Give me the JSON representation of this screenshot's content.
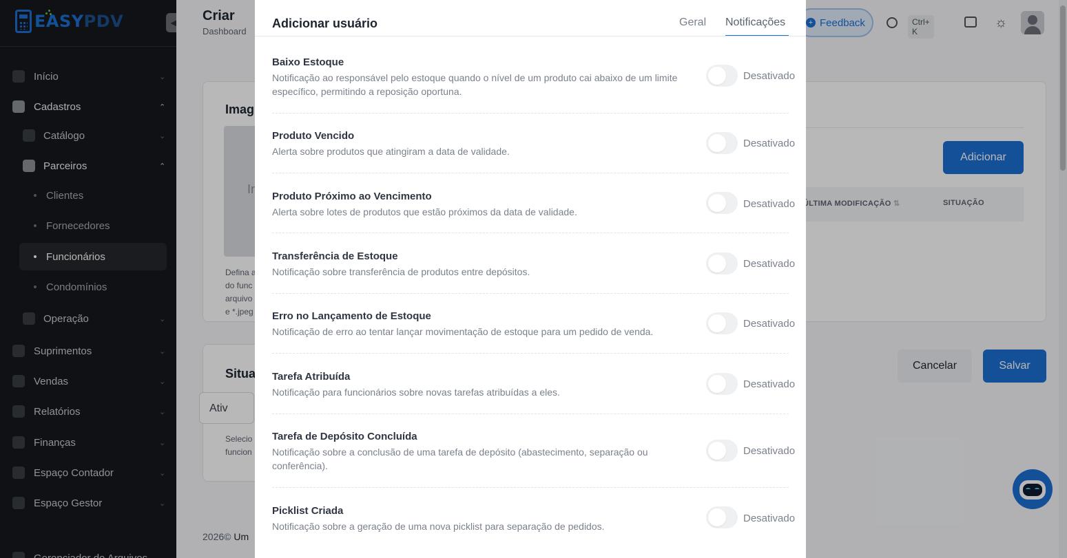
{
  "brand": {
    "name_part1": "EASY",
    "name_part2": "PDV"
  },
  "sidebar": {
    "collapse_icon": "chevron-left-icon",
    "items": [
      {
        "label": "Início",
        "icon": "grid-icon"
      },
      {
        "label": "Cadastros",
        "icon": "id-card-icon"
      },
      {
        "label": "Catálogo",
        "icon": "box-icon"
      },
      {
        "label": "Parceiros",
        "icon": "users-icon"
      },
      {
        "label": "Clientes"
      },
      {
        "label": "Fornecedores"
      },
      {
        "label": "Funcionários"
      },
      {
        "label": "Condomínios"
      },
      {
        "label": "Operação",
        "icon": "cog-box-icon"
      },
      {
        "label": "Suprimentos",
        "icon": "truck-icon"
      },
      {
        "label": "Vendas",
        "icon": "cart-icon"
      },
      {
        "label": "Relatórios",
        "icon": "chart-icon"
      },
      {
        "label": "Finanças",
        "icon": "dollar-icon"
      },
      {
        "label": "Espaço Contador",
        "icon": "calculator-icon"
      },
      {
        "label": "Espaço Gestor",
        "icon": "manager-icon"
      },
      {
        "label": "Gerenciador de Arquivos",
        "icon": "folder-icon"
      }
    ]
  },
  "header": {
    "title": "Criar",
    "breadcrumb": "Dashboard",
    "feedback_label": "Feedback",
    "shortcut": "Ctrl+ K"
  },
  "background": {
    "image_card_title": "Imag",
    "image_placeholder": "Im",
    "image_help": [
      "Defina a",
      "do func",
      "arquivo",
      "e *.jpeg"
    ],
    "status_card_title": "Situa",
    "status_value": "Ativ",
    "status_help": [
      "Selecio",
      "funcion"
    ],
    "add_button": "Adicionar",
    "col_modified": "ÚLTIMA MODIFICAÇÃO",
    "col_status": "SITUAÇÃO",
    "cancel_button": "Cancelar",
    "save_button": "Salvar",
    "footer_year": "2026©",
    "footer_text": "Um"
  },
  "modal": {
    "title": "Adicionar usuário",
    "tabs": [
      {
        "label": "Geral",
        "active": false
      },
      {
        "label": "Notificações",
        "active": true
      }
    ],
    "notifications": [
      {
        "title": "Baixo Estoque",
        "description": "Notificação ao responsável pelo estoque quando o nível de um produto cai abaixo de um limite específico, permitindo a reposição oportuna.",
        "state": "Desativado"
      },
      {
        "title": "Produto Vencido",
        "description": "Alerta sobre produtos que atingiram a data de validade.",
        "state": "Desativado"
      },
      {
        "title": "Produto Próximo ao Vencimento",
        "description": "Alerta sobre lotes de produtos que estão próximos da data de validade.",
        "state": "Desativado"
      },
      {
        "title": "Transferência de Estoque",
        "description": "Notificação sobre transferência de produtos entre depósitos.",
        "state": "Desativado"
      },
      {
        "title": "Erro no Lançamento de Estoque",
        "description": "Notificação de erro ao tentar lançar movimentação de estoque para um pedido de venda.",
        "state": "Desativado"
      },
      {
        "title": "Tarefa Atribuída",
        "description": "Notificação para funcionários sobre novas tarefas atribuídas a eles.",
        "state": "Desativado"
      },
      {
        "title": "Tarefa de Depósito Concluída",
        "description": "Notificação sobre a conclusão de uma tarefa de depósito (abastecimento, separação ou conferência).",
        "state": "Desativado"
      },
      {
        "title": "Picklist Criada",
        "description": "Notificação sobre a geração de uma nova picklist para separação de pedidos.",
        "state": "Desativado"
      }
    ]
  },
  "colors": {
    "accent": "#1c6fd1",
    "sidebar_bg": "#16181c",
    "toggle_off": "#eef0f2"
  }
}
